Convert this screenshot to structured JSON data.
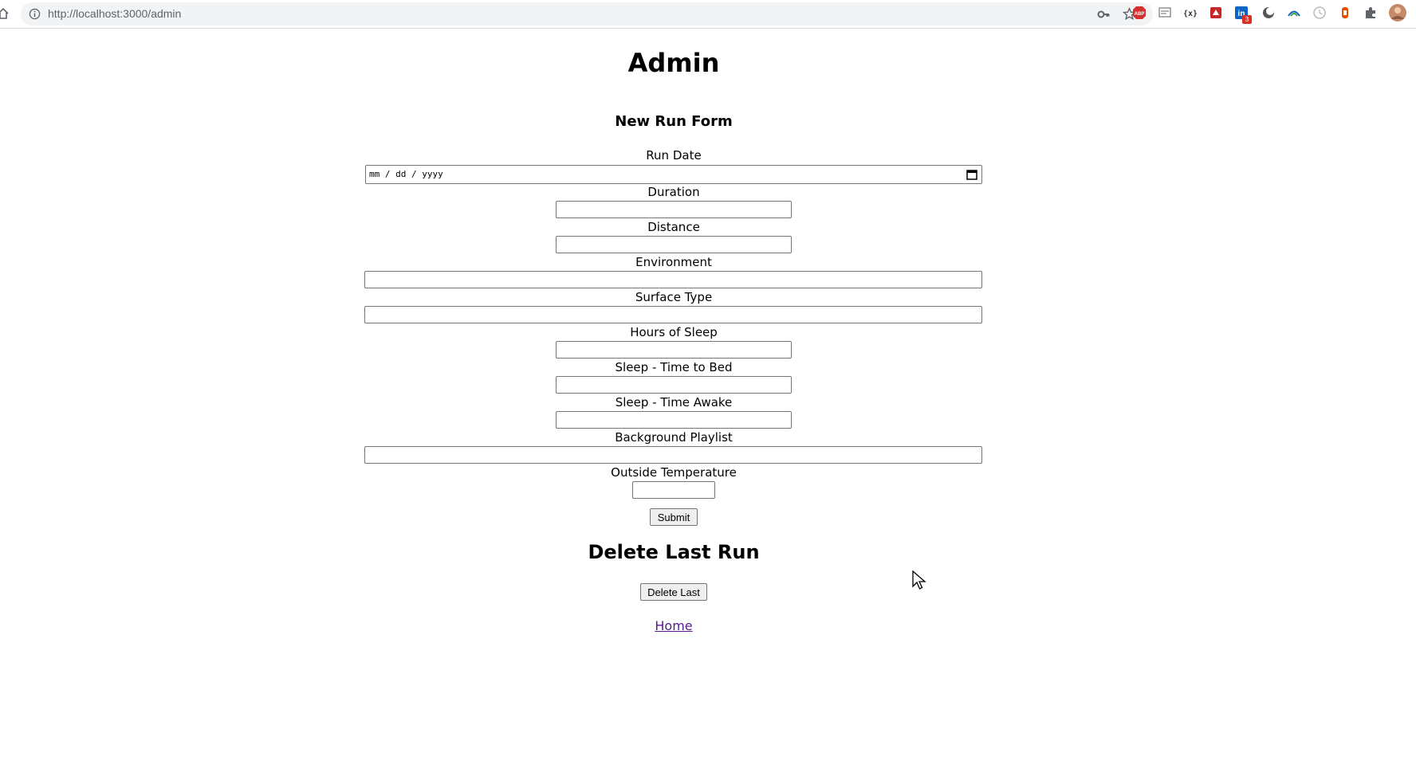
{
  "browser": {
    "url": "http://localhost:3000/admin",
    "extension_badge": "3"
  },
  "page": {
    "title": "Admin",
    "form_heading": "New Run Form",
    "fields": {
      "run_date": {
        "label": "Run Date",
        "placeholder": "mm / dd / yyyy"
      },
      "duration": {
        "label": "Duration",
        "value": ""
      },
      "distance": {
        "label": "Distance",
        "value": ""
      },
      "environment": {
        "label": "Environment",
        "value": ""
      },
      "surface_type": {
        "label": "Surface Type",
        "value": ""
      },
      "hours_of_sleep": {
        "label": "Hours of Sleep",
        "value": ""
      },
      "time_to_bed": {
        "label": "Sleep - Time to Bed",
        "value": ""
      },
      "time_awake": {
        "label": "Sleep - Time Awake",
        "value": ""
      },
      "playlist": {
        "label": "Background Playlist",
        "value": ""
      },
      "temperature": {
        "label": "Outside Temperature",
        "value": ""
      }
    },
    "submit_label": "Submit",
    "delete_heading": "Delete Last Run",
    "delete_label": "Delete Last",
    "home_link": "Home"
  },
  "colors": {
    "link_visited": "#551a8b",
    "button_bg": "#efefef",
    "border": "#767676"
  }
}
